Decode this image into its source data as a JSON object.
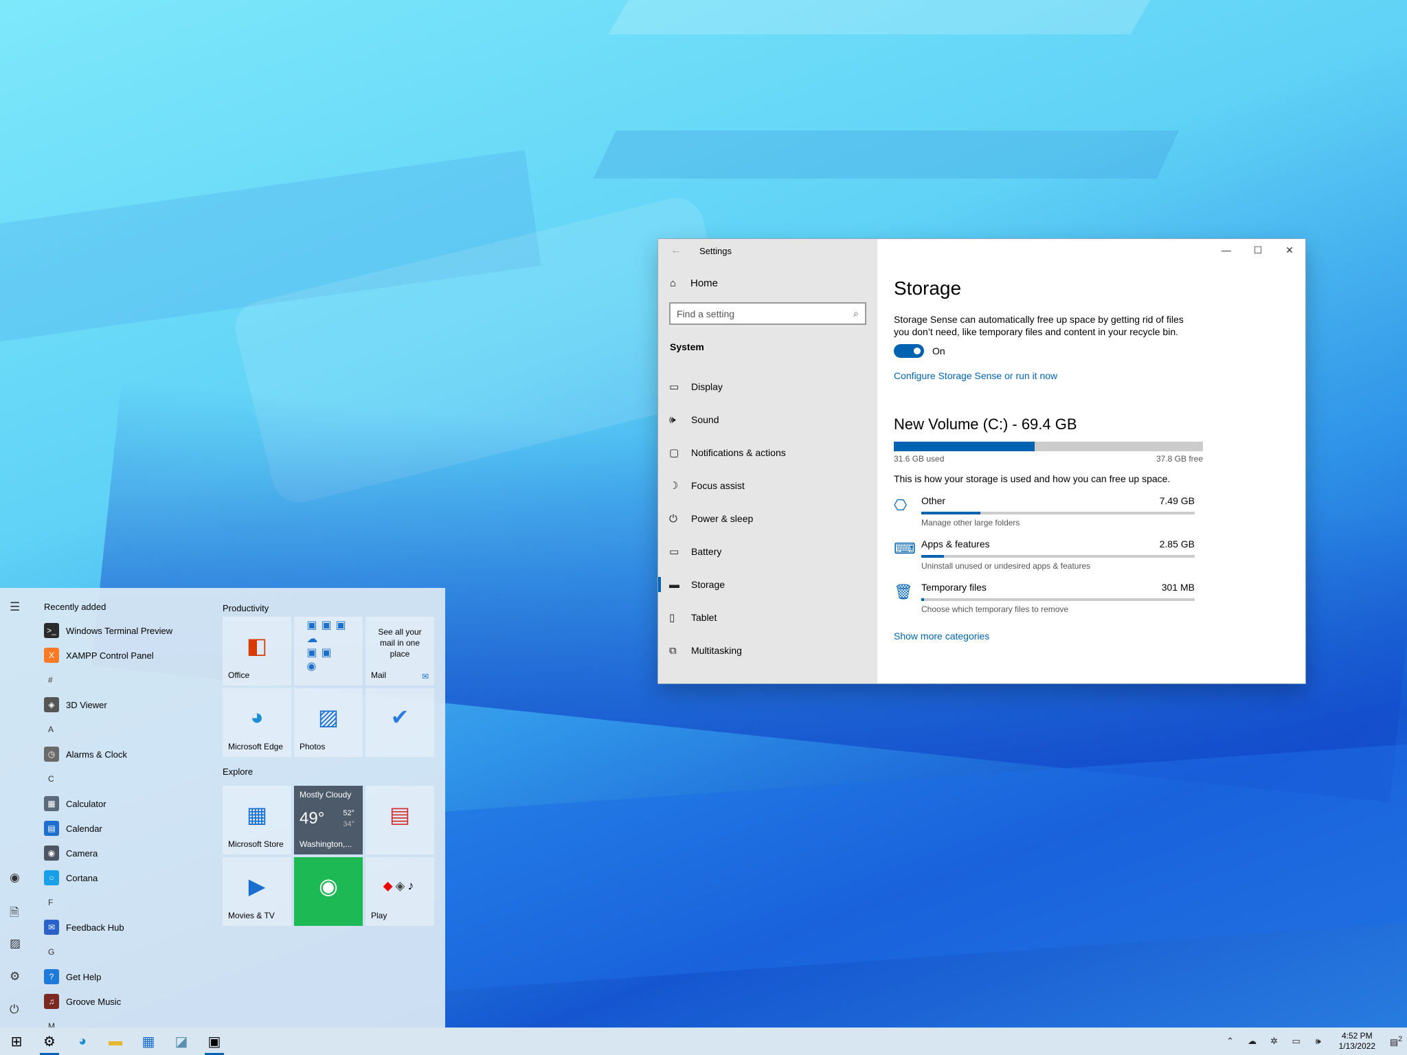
{
  "settings": {
    "title": "Settings",
    "home": "Home",
    "search_placeholder": "Find a setting",
    "section": "System",
    "nav": [
      "Display",
      "Sound",
      "Notifications & actions",
      "Focus assist",
      "Power & sleep",
      "Battery",
      "Storage",
      "Tablet",
      "Multitasking"
    ],
    "active_nav": "Storage",
    "page_title": "Storage",
    "storage_sense_desc": "Storage Sense can automatically free up space by getting rid of files you don’t need, like temporary files and content in your recycle bin.",
    "toggle_state": "On",
    "configure_link": "Configure Storage Sense or run it now",
    "volume_title": "New Volume (C:) - 69.4 GB",
    "used": "31.6 GB used",
    "free": "37.8 GB free",
    "used_fraction": 0.455,
    "how_text": "This is how your storage is used and how you can free up space.",
    "categories": [
      {
        "name": "Other",
        "size": "7.49 GB",
        "sub": "Manage other large folders",
        "fraction": 0.215
      },
      {
        "name": "Apps & features",
        "size": "2.85 GB",
        "sub": "Uninstall unused or undesired apps & features",
        "fraction": 0.082
      },
      {
        "name": "Temporary files",
        "size": "301 MB",
        "sub": "Choose which temporary files to remove",
        "fraction": 0.01
      }
    ],
    "show_more": "Show more categories"
  },
  "start": {
    "recently_added": "Recently added",
    "apps": [
      {
        "type": "app",
        "name": "Windows Terminal Preview",
        "color": "#2b2b2b",
        "glyph": ">_"
      },
      {
        "type": "app",
        "name": "XAMPP Control Panel",
        "color": "#fb7a24",
        "glyph": "X"
      },
      {
        "type": "letter",
        "name": "#"
      },
      {
        "type": "app",
        "name": "3D Viewer",
        "color": "#555555",
        "glyph": "◈"
      },
      {
        "type": "letter",
        "name": "A"
      },
      {
        "type": "app",
        "name": "Alarms & Clock",
        "color": "#6a6a6a",
        "glyph": "◷"
      },
      {
        "type": "letter",
        "name": "C"
      },
      {
        "type": "app",
        "name": "Calculator",
        "color": "#5a6a7a",
        "glyph": "▦"
      },
      {
        "type": "app",
        "name": "Calendar",
        "color": "#1f6fd0",
        "glyph": "▤"
      },
      {
        "type": "app",
        "name": "Camera",
        "color": "#4b5563",
        "glyph": "◉"
      },
      {
        "type": "app",
        "name": "Cortana",
        "color": "#1aa0e8",
        "glyph": "○"
      },
      {
        "type": "letter",
        "name": "F"
      },
      {
        "type": "app",
        "name": "Feedback Hub",
        "color": "#2a62c9",
        "glyph": "✉"
      },
      {
        "type": "letter",
        "name": "G"
      },
      {
        "type": "app",
        "name": "Get Help",
        "color": "#1d7ad9",
        "glyph": "?"
      },
      {
        "type": "app",
        "name": "Groove Music",
        "color": "#7a2a20",
        "glyph": "♫"
      },
      {
        "type": "letter",
        "name": "M"
      }
    ],
    "group_productivity": "Productivity",
    "group_explore": "Explore",
    "tiles_productivity": [
      "Office",
      "",
      "Mail",
      "Microsoft Edge",
      "Photos",
      ""
    ],
    "mail_promo": "See all your mail in one place",
    "tiles_explore": [
      "Microsoft Store",
      "Washington,...",
      "",
      "Movies & TV",
      "",
      "Play"
    ],
    "weather": {
      "condition": "Mostly Cloudy",
      "temp": "49°",
      "high": "52°",
      "low": "34°"
    }
  },
  "taskbar": {
    "time": "4:52 PM",
    "date": "1/13/2022",
    "notif_count": "2"
  }
}
